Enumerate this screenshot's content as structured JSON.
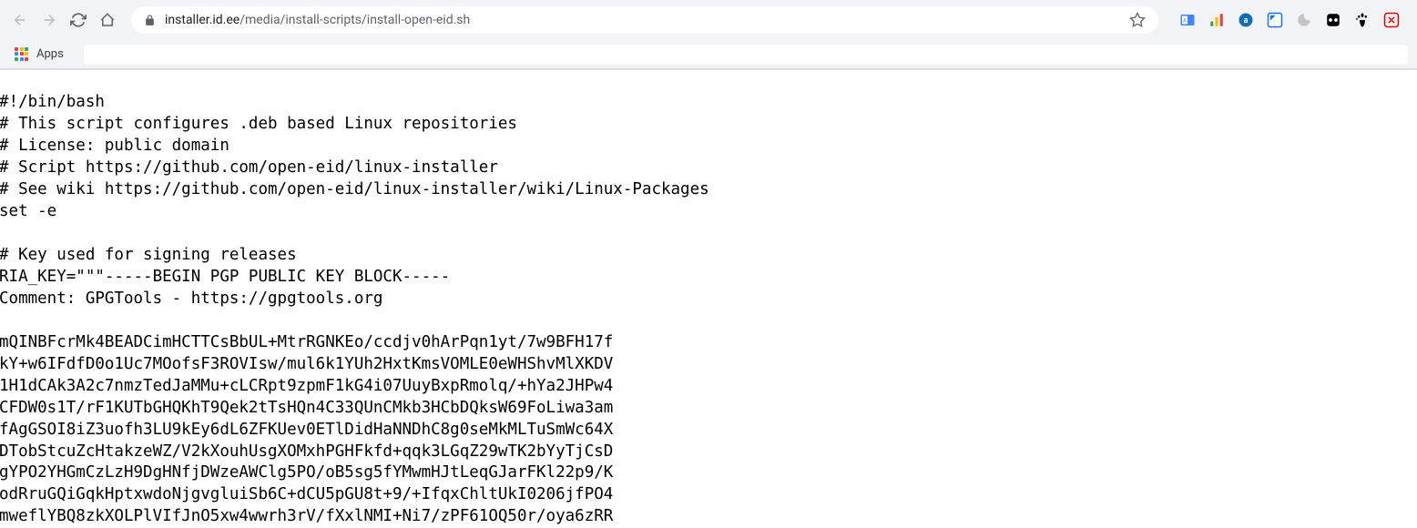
{
  "toolbar": {
    "url_host": "installer.id.ee",
    "url_path": "/media/install-scripts/install-open-eid.sh"
  },
  "bookmarks": {
    "apps_label": "Apps"
  },
  "extensions": {
    "icons": [
      "translate",
      "chart",
      "amazon",
      "screenshot",
      "moon",
      "record",
      "gnome",
      "adblock"
    ]
  },
  "page": {
    "script_text": "#!/bin/bash\n# This script configures .deb based Linux repositories\n# License: public domain\n# Script https://github.com/open-eid/linux-installer\n# See wiki https://github.com/open-eid/linux-installer/wiki/Linux-Packages\nset -e\n\n# Key used for signing releases\nRIA_KEY=\"\"\"-----BEGIN PGP PUBLIC KEY BLOCK-----\nComment: GPGTools - https://gpgtools.org\n\nmQINBFcrMk4BEADCimHCTTCsBbUL+MtrRGNKEo/ccdjv0hArPqn1yt/7w9BFH17f\nkY+w6IFdfD0o1Uc7MOofsF3ROVIsw/mul6k1YUh2HxtKmsVOMLE0eWHShvMlXKDV\n1H1dCAk3A2c7nmzTedJaMMu+cLCRpt9zpmF1kG4i07UuyBxpRmolq/+hYa2JHPw4\nCFDW0s1T/rF1KUTbGHQKhT9Qek2tTsHQn4C33QUnCMkb3HCbDQksW69FoLiwa3am\nfAgGSOI8iZ3uofh3LU9kEy6dL6ZFKUev0ETlDidHaNNDhC8g0seMkMLTuSmWc64X\nDTobStcuZcHtakzeWZ/V2kXouhUsgXOMxhPGHFkfd+qqk3LGqZ29wTK2bYyTjCsD\ngYPO2YHGmCzLzH9DgHNfjDWzeAWClg5PO/oB5sg5fYMwmHJtLeqGJarFKl22p9/K\nodRruGQiGqkHptxwdoNjgvgluiSb6C+dCU5pGU8t+9/+IfqxChltUkI0206jfPO4\nmweflYBQ8zkXOLPlVIfJnO5xw4wwrh3rV/fXxlNMI+Ni7/zPF61OQ50r/oya6zRR"
  }
}
